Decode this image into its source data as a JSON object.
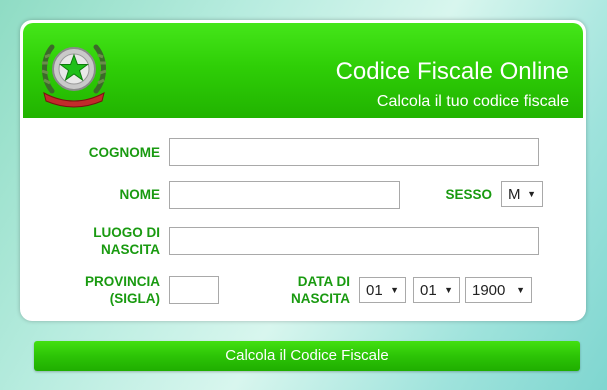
{
  "header": {
    "title": "Codice Fiscale Online",
    "subtitle": "Calcola il tuo codice fiscale",
    "emblem_text": "REPUBBLICA ITALIANA"
  },
  "form": {
    "cognome": {
      "label": "COGNOME",
      "value": "",
      "placeholder": ""
    },
    "nome": {
      "label": "NOME",
      "value": "",
      "placeholder": ""
    },
    "sesso": {
      "label": "SESSO",
      "selected": "M"
    },
    "luogo": {
      "label": "LUOGO DI\nNASCITA",
      "value": "",
      "placeholder": ""
    },
    "provincia": {
      "label": "PROVINCIA\n(SIGLA)",
      "value": "",
      "placeholder": ""
    },
    "data": {
      "label": "DATA DI\nNASCITA",
      "day": "01",
      "month": "01",
      "year": "1900"
    }
  },
  "submit_label": "Calcola il Codice Fiscale",
  "colors": {
    "header_green": "#2fcf07",
    "label_green": "#199a10",
    "button_green": "#2cc406"
  }
}
